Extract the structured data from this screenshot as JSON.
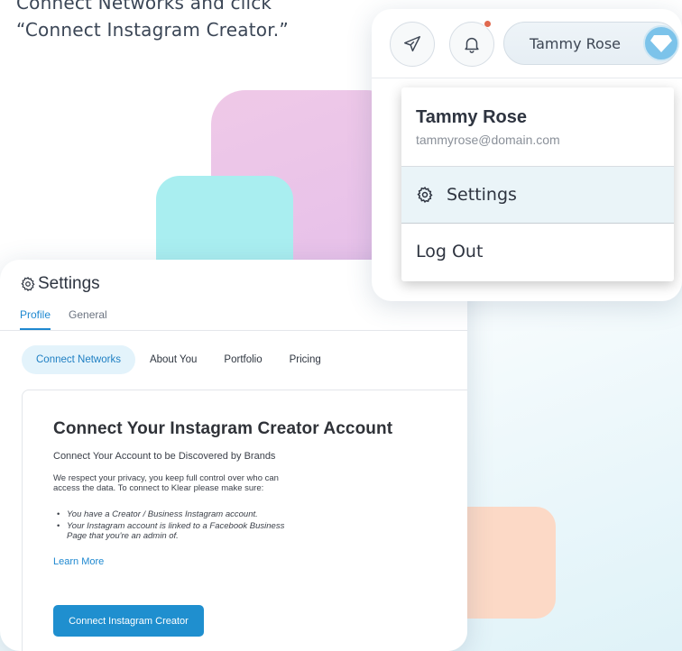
{
  "instruction": {
    "line1": "Connect Networks and click",
    "line2": "“Connect Instagram Creator.”"
  },
  "settings": {
    "title": "Settings",
    "tabs": [
      {
        "label": "Profile",
        "active": true
      },
      {
        "label": "General",
        "active": false
      }
    ],
    "sub_tabs": [
      {
        "label": "Connect Networks",
        "active": true
      },
      {
        "label": "About You",
        "active": false
      },
      {
        "label": "Portfolio",
        "active": false
      },
      {
        "label": "Pricing",
        "active": false
      }
    ],
    "card": {
      "title": "Connect Your Instagram Creator Account",
      "subtitle": "Connect Your Account to be Discovered by Brands",
      "body": "We respect your privacy, you keep full control over who can access the data. To connect to Klear please make sure:",
      "requirements": [
        "You have a Creator / Business Instagram account.",
        "Your Instagram account is linked to a Facebook Business Page that you're an admin of."
      ],
      "learn_more": "Learn More",
      "connect_button": "Connect Instagram Creator"
    }
  },
  "account": {
    "user_name": "Tammy Rose",
    "has_notification": true,
    "icons": {
      "send": "paper-plane-icon",
      "notifications": "bell-icon",
      "avatar": "diamond-icon"
    },
    "dropdown": {
      "name": "Tammy Rose",
      "email": "tammyrose@domain.com",
      "settings_label": "Settings",
      "logout_label": "Log Out"
    }
  },
  "colors": {
    "accent_blue": "#1f8fcf",
    "active_tab_bg": "#e3f3fb",
    "notification_dot": "#e0694f",
    "avatar_bg": "#7cc3ea"
  }
}
